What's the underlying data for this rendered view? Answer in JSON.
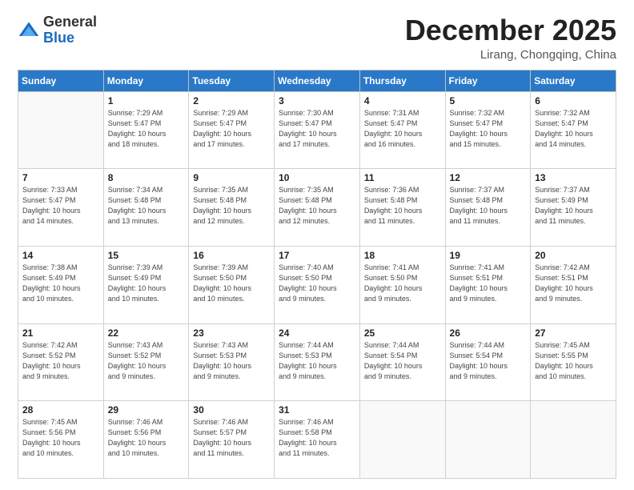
{
  "logo": {
    "general": "General",
    "blue": "Blue"
  },
  "header": {
    "month_year": "December 2025",
    "location": "Lirang, Chongqing, China"
  },
  "weekdays": [
    "Sunday",
    "Monday",
    "Tuesday",
    "Wednesday",
    "Thursday",
    "Friday",
    "Saturday"
  ],
  "weeks": [
    [
      {
        "day": "",
        "info": ""
      },
      {
        "day": "1",
        "info": "Sunrise: 7:29 AM\nSunset: 5:47 PM\nDaylight: 10 hours\nand 18 minutes."
      },
      {
        "day": "2",
        "info": "Sunrise: 7:29 AM\nSunset: 5:47 PM\nDaylight: 10 hours\nand 17 minutes."
      },
      {
        "day": "3",
        "info": "Sunrise: 7:30 AM\nSunset: 5:47 PM\nDaylight: 10 hours\nand 17 minutes."
      },
      {
        "day": "4",
        "info": "Sunrise: 7:31 AM\nSunset: 5:47 PM\nDaylight: 10 hours\nand 16 minutes."
      },
      {
        "day": "5",
        "info": "Sunrise: 7:32 AM\nSunset: 5:47 PM\nDaylight: 10 hours\nand 15 minutes."
      },
      {
        "day": "6",
        "info": "Sunrise: 7:32 AM\nSunset: 5:47 PM\nDaylight: 10 hours\nand 14 minutes."
      }
    ],
    [
      {
        "day": "7",
        "info": "Sunrise: 7:33 AM\nSunset: 5:47 PM\nDaylight: 10 hours\nand 14 minutes."
      },
      {
        "day": "8",
        "info": "Sunrise: 7:34 AM\nSunset: 5:48 PM\nDaylight: 10 hours\nand 13 minutes."
      },
      {
        "day": "9",
        "info": "Sunrise: 7:35 AM\nSunset: 5:48 PM\nDaylight: 10 hours\nand 12 minutes."
      },
      {
        "day": "10",
        "info": "Sunrise: 7:35 AM\nSunset: 5:48 PM\nDaylight: 10 hours\nand 12 minutes."
      },
      {
        "day": "11",
        "info": "Sunrise: 7:36 AM\nSunset: 5:48 PM\nDaylight: 10 hours\nand 11 minutes."
      },
      {
        "day": "12",
        "info": "Sunrise: 7:37 AM\nSunset: 5:48 PM\nDaylight: 10 hours\nand 11 minutes."
      },
      {
        "day": "13",
        "info": "Sunrise: 7:37 AM\nSunset: 5:49 PM\nDaylight: 10 hours\nand 11 minutes."
      }
    ],
    [
      {
        "day": "14",
        "info": "Sunrise: 7:38 AM\nSunset: 5:49 PM\nDaylight: 10 hours\nand 10 minutes."
      },
      {
        "day": "15",
        "info": "Sunrise: 7:39 AM\nSunset: 5:49 PM\nDaylight: 10 hours\nand 10 minutes."
      },
      {
        "day": "16",
        "info": "Sunrise: 7:39 AM\nSunset: 5:50 PM\nDaylight: 10 hours\nand 10 minutes."
      },
      {
        "day": "17",
        "info": "Sunrise: 7:40 AM\nSunset: 5:50 PM\nDaylight: 10 hours\nand 9 minutes."
      },
      {
        "day": "18",
        "info": "Sunrise: 7:41 AM\nSunset: 5:50 PM\nDaylight: 10 hours\nand 9 minutes."
      },
      {
        "day": "19",
        "info": "Sunrise: 7:41 AM\nSunset: 5:51 PM\nDaylight: 10 hours\nand 9 minutes."
      },
      {
        "day": "20",
        "info": "Sunrise: 7:42 AM\nSunset: 5:51 PM\nDaylight: 10 hours\nand 9 minutes."
      }
    ],
    [
      {
        "day": "21",
        "info": "Sunrise: 7:42 AM\nSunset: 5:52 PM\nDaylight: 10 hours\nand 9 minutes."
      },
      {
        "day": "22",
        "info": "Sunrise: 7:43 AM\nSunset: 5:52 PM\nDaylight: 10 hours\nand 9 minutes."
      },
      {
        "day": "23",
        "info": "Sunrise: 7:43 AM\nSunset: 5:53 PM\nDaylight: 10 hours\nand 9 minutes."
      },
      {
        "day": "24",
        "info": "Sunrise: 7:44 AM\nSunset: 5:53 PM\nDaylight: 10 hours\nand 9 minutes."
      },
      {
        "day": "25",
        "info": "Sunrise: 7:44 AM\nSunset: 5:54 PM\nDaylight: 10 hours\nand 9 minutes."
      },
      {
        "day": "26",
        "info": "Sunrise: 7:44 AM\nSunset: 5:54 PM\nDaylight: 10 hours\nand 9 minutes."
      },
      {
        "day": "27",
        "info": "Sunrise: 7:45 AM\nSunset: 5:55 PM\nDaylight: 10 hours\nand 10 minutes."
      }
    ],
    [
      {
        "day": "28",
        "info": "Sunrise: 7:45 AM\nSunset: 5:56 PM\nDaylight: 10 hours\nand 10 minutes."
      },
      {
        "day": "29",
        "info": "Sunrise: 7:46 AM\nSunset: 5:56 PM\nDaylight: 10 hours\nand 10 minutes."
      },
      {
        "day": "30",
        "info": "Sunrise: 7:46 AM\nSunset: 5:57 PM\nDaylight: 10 hours\nand 11 minutes."
      },
      {
        "day": "31",
        "info": "Sunrise: 7:46 AM\nSunset: 5:58 PM\nDaylight: 10 hours\nand 11 minutes."
      },
      {
        "day": "",
        "info": ""
      },
      {
        "day": "",
        "info": ""
      },
      {
        "day": "",
        "info": ""
      }
    ]
  ]
}
